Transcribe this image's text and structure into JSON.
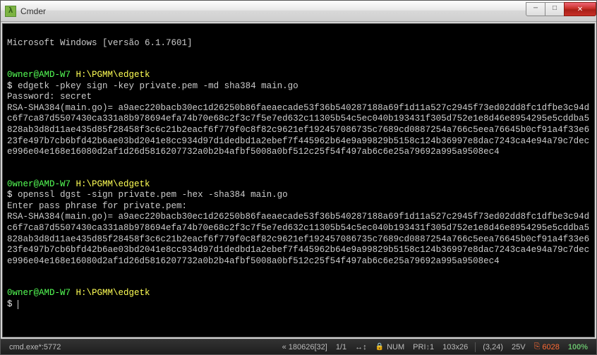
{
  "window": {
    "title": "Cmder"
  },
  "terminal": {
    "banner": "Microsoft Windows [versão 6.1.7601]",
    "prompt_user": "0wner@AMD-W7",
    "prompt_path": "H:\\PGMM\\edgetk",
    "prompt_symbol": "$",
    "cmd1": "edgetk -pkey sign -key private.pem -md sha384 main.go",
    "pw_label": "Password:",
    "pw_value": "secret",
    "hash_output": "RSA-SHA384(main.go)= a9aec220bacb30ec1d26250b86faeaecade53f36b540287188a69f1d11a527c2945f73ed02dd8fc1dfbe3c94dc6f7ca87d5507430ca331a8b978694efa74b70e68c2f3c7f5e7ed632c11305b54c5ec040b193431f305d752e1e8d46e8954295e5cddba5828ab3d8d11ae435d85f28458f3c6c21b2eacf6f779f0c8f82c9621ef192457086735c7689cd0887254a766c5eea76645b0cf91a4f33e623fe497b7cb6bfd42b6ae03bd2041e8cc934d97d1dedbd1a2ebef7f445962b64e9a99829b5158c124b36997e8dac7243ca4e94a79c7dece996e04e168e16080d2af1d26d5816207732a0b2b4afbf5008a0bf512c25f54f497ab6c6e25a79692a995a9508ec4",
    "cmd2": "openssl dgst -sign private.pem -hex -sha384 main.go",
    "pass_prompt": "Enter pass phrase for private.pem:"
  },
  "status": {
    "left": "cmd.exe*:5772",
    "lineinfo": "« 180626[32]",
    "pos1": "1/1",
    "arrows": "↔↕",
    "num": "NUM",
    "pri": "PRI",
    "pricount": "1",
    "dim": "103x26",
    "cursor": "(3,24)",
    "vt": "25V",
    "conn": "6028",
    "pct": "100%"
  }
}
